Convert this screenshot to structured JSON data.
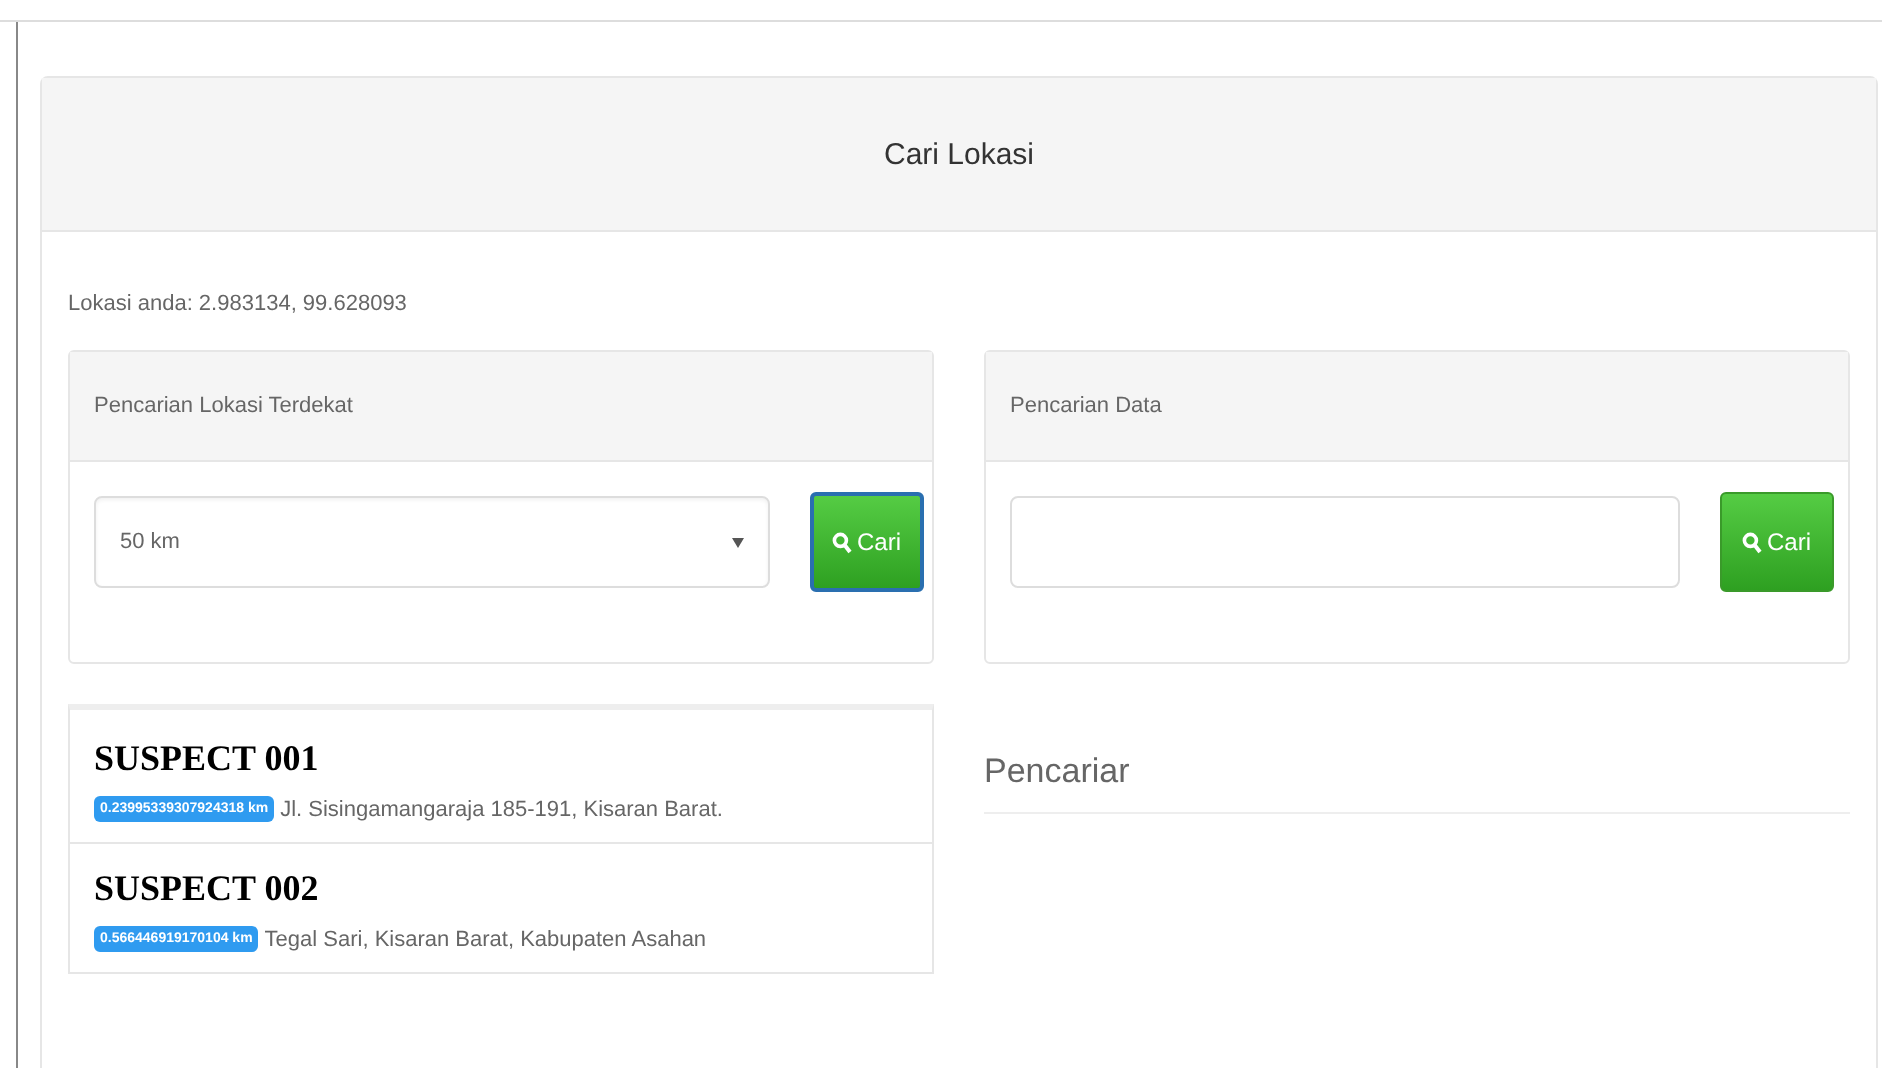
{
  "title": "Cari Lokasi",
  "location": "Lokasi anda: 2.983134, 99.628093",
  "nearest": {
    "heading": "Pencarian Lokasi Terdekat",
    "select_value": "50 km",
    "button": "Cari"
  },
  "data_search": {
    "heading": "Pencarian Data",
    "button": "Cari"
  },
  "results": [
    {
      "name": "SUSPECT 001",
      "distance": "0.23995339307924318 km",
      "address": "Jl. Sisingamangaraja 185-191, Kisaran Barat."
    },
    {
      "name": "SUSPECT 002",
      "distance": "0.566446919170104 km",
      "address": "Tegal Sari, Kisaran Barat, Kabupaten Asahan"
    }
  ],
  "results_heading": "Pencariar"
}
